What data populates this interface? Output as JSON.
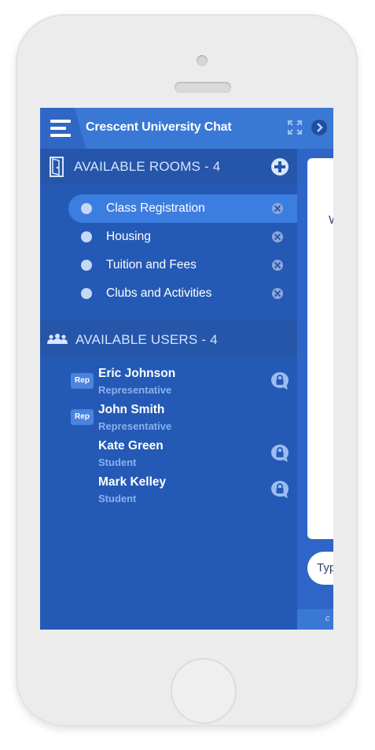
{
  "app": {
    "title": "Crescent University Chat"
  },
  "rooms": {
    "header": "AVAILABLE ROOMS - 4",
    "items": [
      {
        "label": "Class Registration",
        "active": true
      },
      {
        "label": "Housing",
        "active": false
      },
      {
        "label": "Tuition and Fees",
        "active": false
      },
      {
        "label": "Clubs and Activities",
        "active": false
      }
    ]
  },
  "users": {
    "header": "AVAILABLE USERS - 4",
    "items": [
      {
        "name": "Eric Johnson",
        "role": "Representative",
        "badge": "Rep",
        "locked": true
      },
      {
        "name": "John Smith",
        "role": "Representative",
        "badge": "Rep",
        "locked": false
      },
      {
        "name": "Kate Green",
        "role": "Student",
        "badge": "",
        "locked": true
      },
      {
        "name": "Mark Kelley",
        "role": "Student",
        "badge": "",
        "locked": true
      }
    ]
  },
  "chat": {
    "message_partial": "W",
    "input_placeholder": "Typ",
    "footer_partial": "c"
  },
  "icons": [
    "hamburger-icon",
    "expand-icon",
    "chevron-right-icon",
    "door-icon",
    "plus-icon",
    "close-icon",
    "users-icon",
    "lock-chat-icon"
  ],
  "colors": {
    "primary": "#3a78d6",
    "sidebar": "#245ab5",
    "active": "#3c7de0",
    "role_text": "#8ab1ee"
  }
}
